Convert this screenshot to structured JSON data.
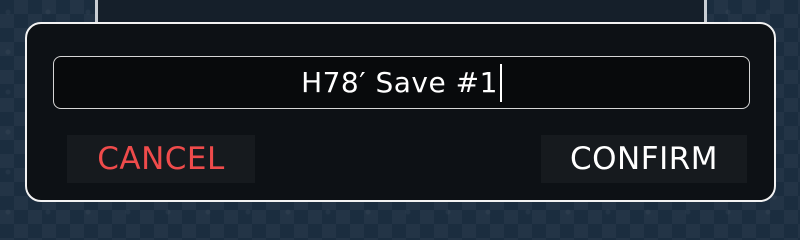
{
  "dialog": {
    "name_value": "H78′ Save #1"
  },
  "buttons": {
    "cancel_label": "CANCEL",
    "confirm_label": "CONFIRM"
  },
  "colors": {
    "cancel": "#ef4b4b",
    "confirm": "#ffffff",
    "dialog_border": "#f2f2f2",
    "dialog_background": "#0d1115"
  }
}
